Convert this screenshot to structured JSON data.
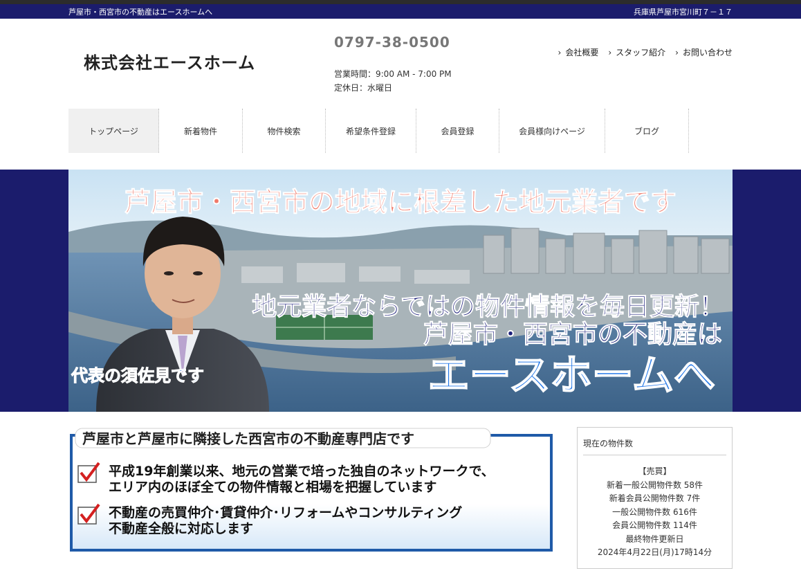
{
  "topbar": {
    "tagline": "芦屋市・西宮市の不動産はエースホームへ",
    "address": "兵庫県芦屋市宮川町７－１７"
  },
  "header": {
    "company_name": "株式会社エースホーム",
    "phone": "0797-38-0500",
    "hours": "営業時間：9:00 AM - 7:00 PM",
    "holiday": "定休日：水曜日",
    "links": [
      "会社概要",
      "スタッフ紹介",
      "お問い合わせ"
    ]
  },
  "nav": {
    "items": [
      "トップページ",
      "新着物件",
      "物件検索",
      "希望条件登録",
      "会員登録",
      "会員様向けページ",
      "ブログ"
    ]
  },
  "hero": {
    "headline": "芦屋市・西宮市の地域に根差した地元業者です",
    "line1": "地元業者ならではの物件情報を毎日更新！",
    "line2": "芦屋市・西宮市の不動産は",
    "line3": "エースホームへ",
    "caption": "代表の須佐見です"
  },
  "intro": {
    "title": "芦屋市と芦屋市に隣接した西宮市の不動産専門店です",
    "point1_line1": "平成19年創業以来、地元の営業で培った独自のネットワークで、",
    "point1_line2": "エリア内のほぼ全ての物件情報と相場を把握しています",
    "point2_line1": "不動産の売買仲介･賃貸仲介･リフォームやコンサルティング",
    "point2_line2": "不動産全般に対応します"
  },
  "sidebar": {
    "title": "現在の物件数",
    "section": "【売買】",
    "lines": [
      "新着一般公開物件数 58件",
      "新着会員公開物件数 7件",
      "一般公開物件数 616件",
      "会員公開物件数 114件",
      "最終物件更新日",
      "2024年4月22日(月)17時14分"
    ]
  },
  "colors": {
    "navy": "#1b1c6c",
    "hero_headline": "#f07a6a",
    "hero_text": "#1a1e7a",
    "hero_accent": "#2277e8",
    "check_red": "#d42020"
  }
}
